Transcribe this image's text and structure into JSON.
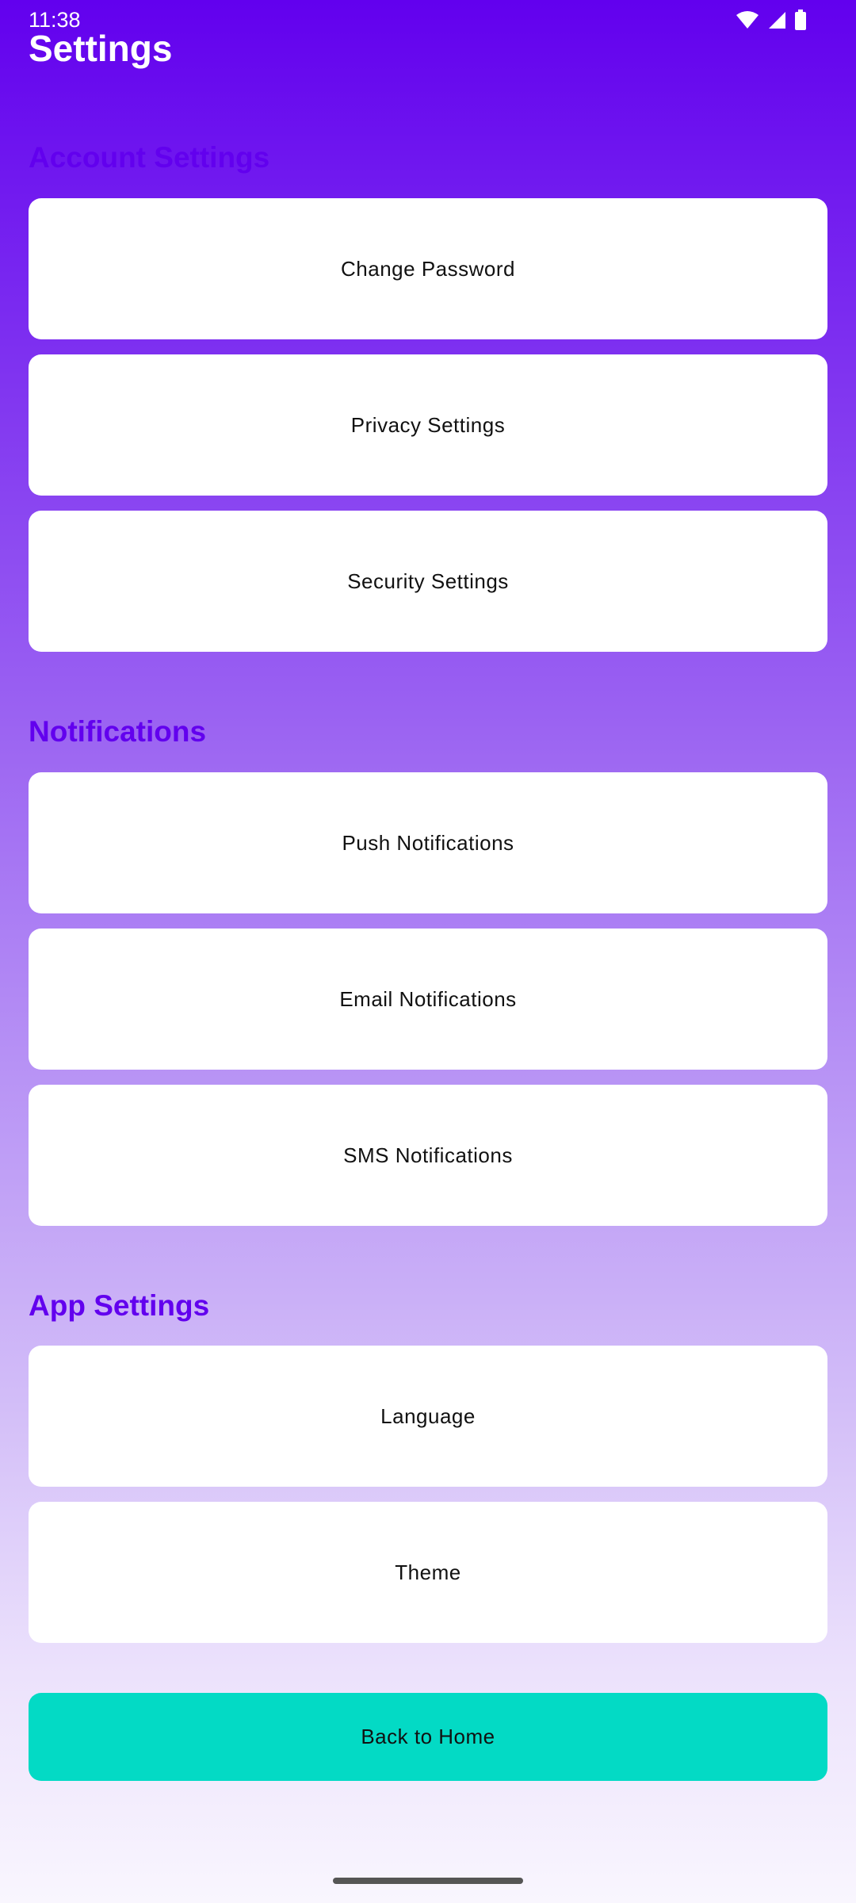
{
  "status_bar": {
    "time": "11:38",
    "icons": [
      "wifi-icon",
      "cellular-signal-icon",
      "battery-icon"
    ]
  },
  "header": {
    "title": "Settings"
  },
  "sections": [
    {
      "heading": "Account Settings",
      "items": [
        {
          "label": "Change Password"
        },
        {
          "label": "Privacy Settings"
        },
        {
          "label": "Security Settings"
        }
      ]
    },
    {
      "heading": "Notifications",
      "items": [
        {
          "label": "Push Notifications"
        },
        {
          "label": "Email Notifications"
        },
        {
          "label": "SMS Notifications"
        }
      ]
    },
    {
      "heading": "App Settings",
      "items": [
        {
          "label": "Language"
        },
        {
          "label": "Theme"
        }
      ]
    }
  ],
  "footer": {
    "back_home_label": "Back to Home"
  },
  "colors": {
    "primary": "#6200EE",
    "accent": "#03DAC5",
    "card": "#FFFFFF"
  }
}
